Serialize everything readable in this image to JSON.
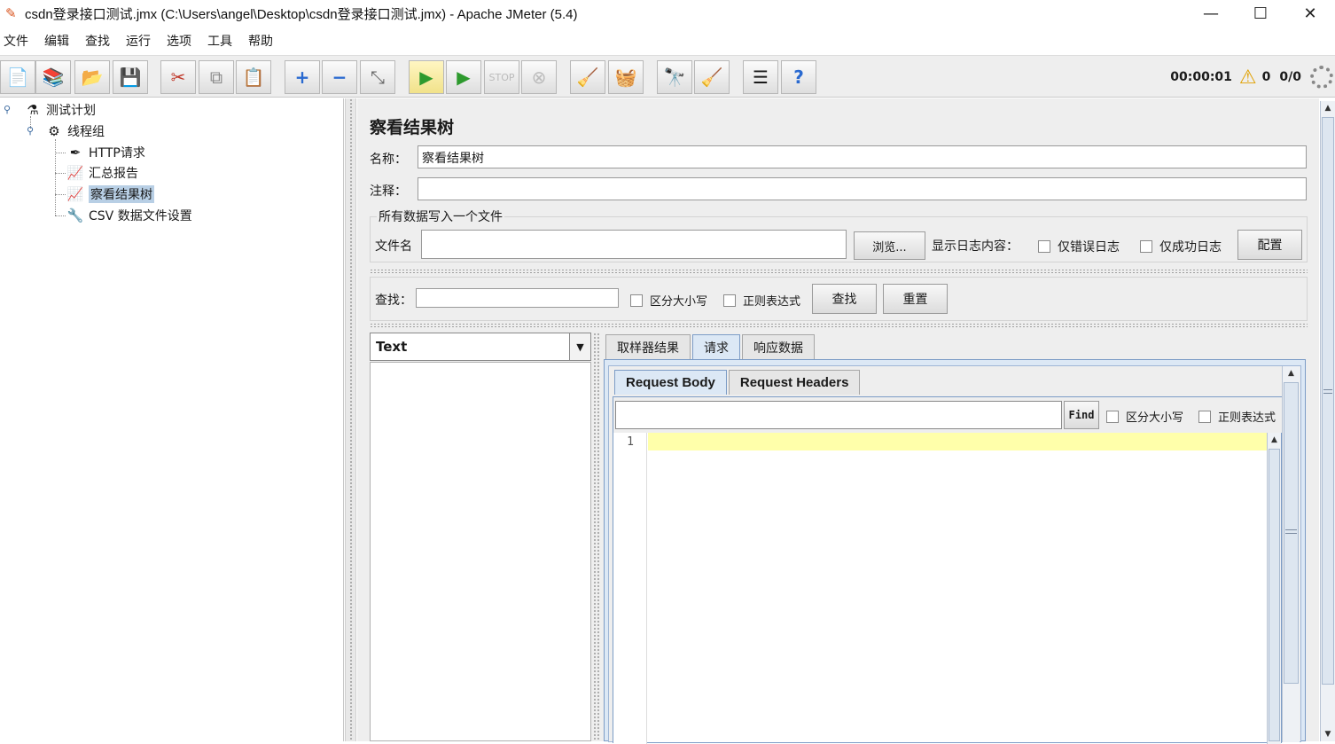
{
  "window": {
    "title": "csdn登录接口测试.jmx (C:\\Users\\angel\\Desktop\\csdn登录接口测试.jmx) - Apache JMeter (5.4)",
    "minimize": "—",
    "maximize": "☐",
    "close": "✕"
  },
  "menu": [
    "文件",
    "编辑",
    "查找",
    "运行",
    "选项",
    "工具",
    "帮助"
  ],
  "toolbar": {
    "timer": "00:00:01",
    "warning_count": "0",
    "threads": "0/0"
  },
  "tree": {
    "root": "测试计划",
    "thread_group": "线程组",
    "children": [
      "HTTP请求",
      "汇总报告",
      "察看结果树",
      "CSV 数据文件设置"
    ],
    "selected": "察看结果树"
  },
  "panel": {
    "title": "察看结果树",
    "name_label": "名称：",
    "name_value": "察看结果树",
    "comment_label": "注释：",
    "comment_value": "",
    "file_group_title": "所有数据写入一个文件",
    "file_label": "文件名",
    "file_value": "",
    "browse_button": "浏览...",
    "log_label": "显示日志内容：",
    "errors_only": "仅错误日志",
    "success_only": "仅成功日志",
    "config_button": "配置",
    "search_label": "查找：",
    "search_value": "",
    "case_sensitive": "区分大小写",
    "regex": "正则表达式",
    "find_button": "查找",
    "reset_button": "重置"
  },
  "results": {
    "renderer": "Text",
    "tabs": [
      "取样器结果",
      "请求",
      "响应数据"
    ],
    "active_tab": "请求",
    "inner_tabs": [
      "Request Body",
      "Request Headers"
    ],
    "active_inner_tab": "Request Body",
    "find_button": "Find",
    "case_sensitive": "区分大小写",
    "regex": "正则表达式",
    "line_number": "1"
  }
}
